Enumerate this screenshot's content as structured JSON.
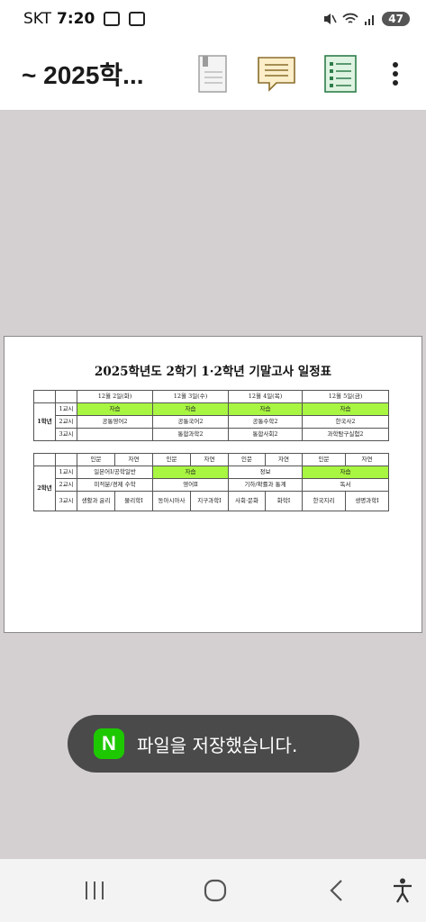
{
  "status_bar": {
    "carrier": "SKT",
    "time": "7:20",
    "battery": "47"
  },
  "toolbar": {
    "title": "~ 2025학..."
  },
  "document": {
    "title": "2025학년도 2학기 1·2학년 기말고사 일정표",
    "grade1": {
      "label": "1학년",
      "dates": [
        "12월 2일(화)",
        "12월 3일(수)",
        "12월 4일(목)",
        "12월 5일(금)"
      ],
      "periods": [
        {
          "period": "1교시",
          "cells": [
            "자습",
            "자습",
            "자습",
            "자습"
          ]
        },
        {
          "period": "2교시",
          "cells": [
            "공통영어2",
            "공통국어2",
            "공통수학2",
            "한국사2"
          ]
        },
        {
          "period": "3교시",
          "cells": [
            "",
            "통합과학2",
            "통합사회2",
            "과학탐구실험2"
          ]
        }
      ]
    },
    "grade2": {
      "label": "2학년",
      "tracks": [
        "인문",
        "자연",
        "인문",
        "자연",
        "인문",
        "자연",
        "인문",
        "자연"
      ],
      "period1": {
        "period": "1교시",
        "d1": "일본어Ⅰ/공학일반",
        "d2": "자습",
        "d3": "정보",
        "d4": "자습"
      },
      "period2": {
        "period": "2교시",
        "d1": "미적분/경제 수학",
        "d2": "영어Ⅱ",
        "d3": "기하/확률과 통계",
        "d4": "독서"
      },
      "period3": {
        "period": "3교시",
        "cells": [
          "생활과 윤리",
          "물리학Ⅰ",
          "동아시아사",
          "지구과학Ⅰ",
          "사회·문화",
          "화학Ⅰ",
          "한국지리",
          "생명과학Ⅰ"
        ]
      }
    }
  },
  "toast": {
    "icon_letter": "N",
    "message": "파일을 저장했습니다."
  }
}
